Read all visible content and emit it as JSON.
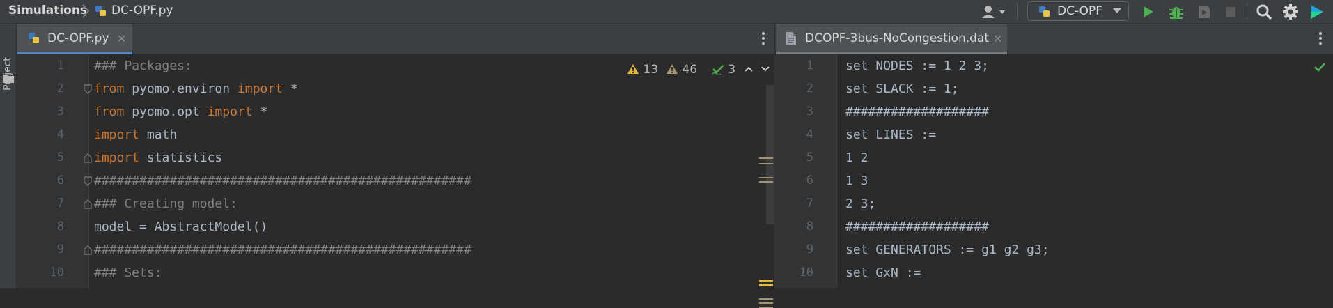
{
  "navbar": {
    "project": "Simulations",
    "file": "DC-OPF.py",
    "run_config": "DC-OPF"
  },
  "toolstrip": {
    "project_label": "Project"
  },
  "left_pane": {
    "tab_label": "DC-OPF.py",
    "inspections": {
      "warnings": "13",
      "weak_warnings": "46",
      "typos": "3"
    },
    "line_numbers": [
      "1",
      "2",
      "3",
      "4",
      "5",
      "6",
      "7",
      "8",
      "9",
      "10"
    ],
    "lines": [
      [
        {
          "t": "### Packages:",
          "c": "cm"
        }
      ],
      [
        {
          "t": "from",
          "c": "kw"
        },
        {
          "t": " pyomo.environ ",
          "c": ""
        },
        {
          "t": "import",
          "c": "kw"
        },
        {
          "t": " *",
          "c": ""
        }
      ],
      [
        {
          "t": "from",
          "c": "kw"
        },
        {
          "t": " pyomo.opt ",
          "c": ""
        },
        {
          "t": "import",
          "c": "kw"
        },
        {
          "t": " *",
          "c": ""
        }
      ],
      [
        {
          "t": "import",
          "c": "kw"
        },
        {
          "t": " math",
          "c": ""
        }
      ],
      [
        {
          "t": "import",
          "c": "kw"
        },
        {
          "t": " statistics",
          "c": ""
        }
      ],
      [
        {
          "t": "##################################################",
          "c": "cm"
        }
      ],
      [
        {
          "t": "### Creating model:",
          "c": "cm"
        }
      ],
      [
        {
          "t": "model = AbstractModel()",
          "c": ""
        }
      ],
      [
        {
          "t": "##################################################",
          "c": "cm"
        }
      ],
      [
        {
          "t": "### Sets:",
          "c": "cm"
        }
      ]
    ]
  },
  "right_pane": {
    "tab_label": "DCOPF-3bus-NoCongestion.dat",
    "line_numbers": [
      "1",
      "2",
      "3",
      "4",
      "5",
      "6",
      "7",
      "8",
      "9",
      "10"
    ],
    "lines": [
      "set NODES := 1 2 3;",
      "set SLACK := 1;",
      "###################",
      "set LINES :=",
      "1 2",
      "1 3",
      "2 3;",
      "###################",
      "set GENERATORS := g1 g2 g3;",
      "set GxN :="
    ]
  },
  "colors": {
    "keyword": "#cc7832",
    "comment": "#808080",
    "text": "#a9b7c6",
    "run_green": "#4fae4f",
    "warning_yellow": "#e5b93a"
  }
}
